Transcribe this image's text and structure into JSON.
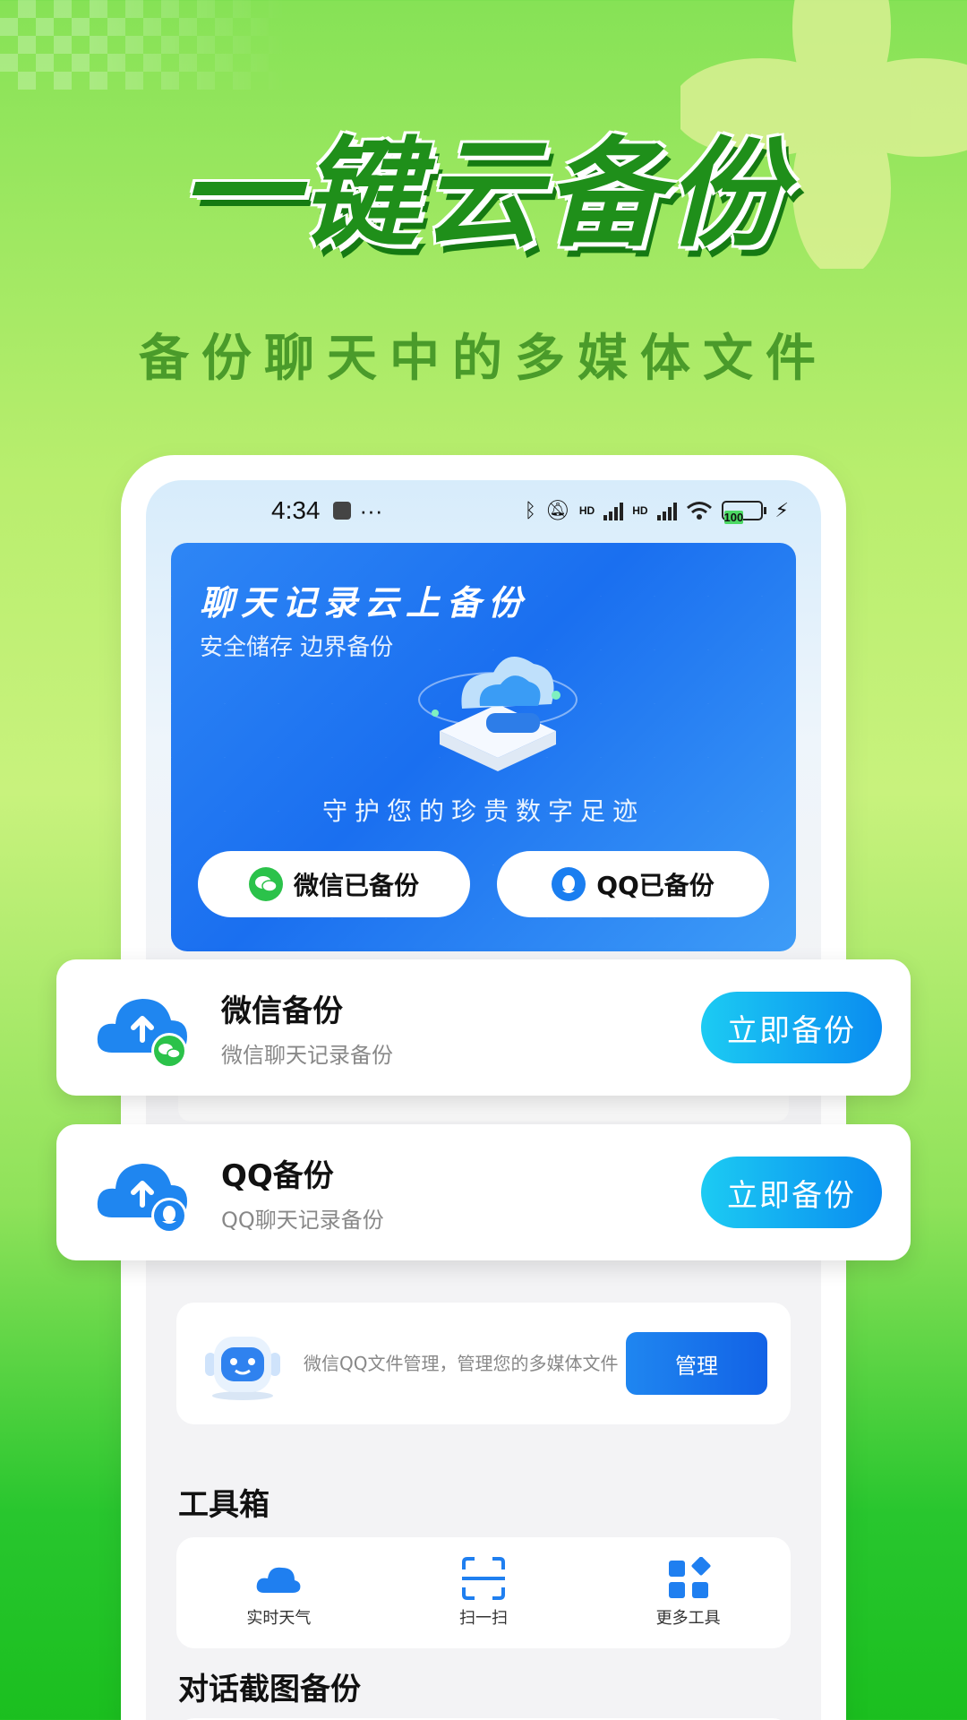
{
  "poster": {
    "headline": "一键云备份",
    "subheadline": "备份聊天中的多媒体文件"
  },
  "statusbar": {
    "time": "4:34",
    "misc": "···",
    "hd1": "HD",
    "hd2": "HD",
    "battery": "100"
  },
  "banner": {
    "title": "聊天记录云上备份",
    "subtitle": "安全储存 边界备份",
    "tagline": "守护您的珍贵数字足迹",
    "wechat_status": "微信已备份",
    "qq_status": "QQ已备份"
  },
  "cards": {
    "wechat": {
      "title": "微信备份",
      "desc": "微信聊天记录备份",
      "button": "立即备份"
    },
    "qq": {
      "title": "QQ备份",
      "desc": "QQ聊天记录备份",
      "button": "立即备份"
    }
  },
  "manager": {
    "text": "微信QQ文件管理，管理您的多媒体文件",
    "button": "管理"
  },
  "toolbox": {
    "title": "工具箱",
    "items": [
      {
        "label": "实时天气",
        "icon": "cloud-icon"
      },
      {
        "label": "扫一扫",
        "icon": "scan-icon"
      },
      {
        "label": "更多工具",
        "icon": "apps-icon"
      }
    ]
  },
  "screenshot_backup": {
    "title": "对话截图备份"
  },
  "colors": {
    "brand_green": "#1f8f1a",
    "accent_blue": "#1a6ff0",
    "button_cyan": "#1ccbf3"
  }
}
